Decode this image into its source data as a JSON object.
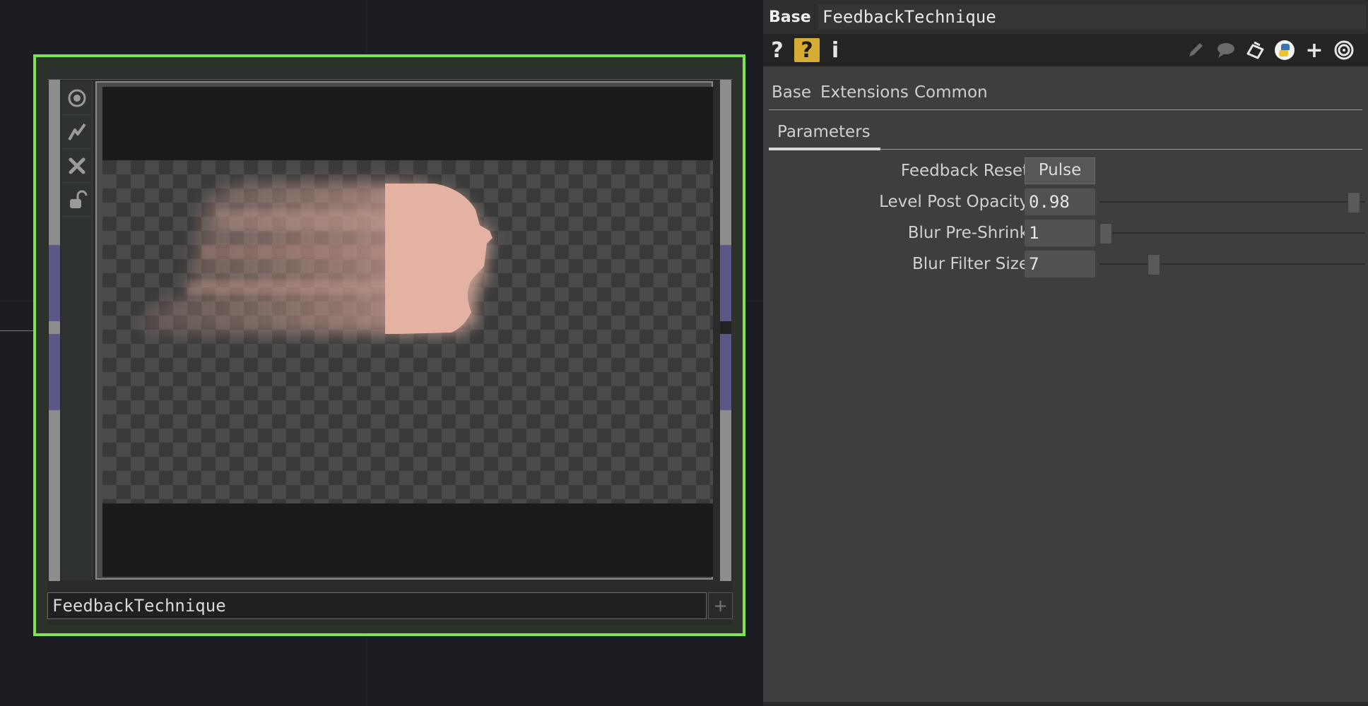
{
  "network": {
    "node": {
      "name": "FeedbackTechnique",
      "side_icons": [
        "viewer-icon",
        "bypass-icon",
        "close-icon",
        "lock-icon"
      ],
      "plus_glyph": "+"
    }
  },
  "panel": {
    "op_type": "Base",
    "op_name": "FeedbackTechnique",
    "toolbar": {
      "help_glyph": "?",
      "help_python_glyph": "?",
      "info_glyph": "i",
      "plus_glyph": "+"
    },
    "page_tabs": [
      "Base",
      "Extensions",
      "Common"
    ],
    "sub_tabs": [
      "Parameters"
    ],
    "params": [
      {
        "label": "Feedback Reset",
        "button": "Pulse"
      },
      {
        "label": "Level Post Opacity",
        "value": "0.98",
        "slider_fraction": 0.98
      },
      {
        "label": "Blur Pre-Shrink",
        "value": "1",
        "slider_fraction": 0.0
      },
      {
        "label": "Blur Filter Size",
        "value": "7",
        "slider_fraction": 0.19
      }
    ]
  },
  "colors": {
    "node_selected_border": "#7fe34f",
    "help_badge": "#d6ad34",
    "panel_bg": "#3e3e3e",
    "skin": "#e0b0a0"
  }
}
